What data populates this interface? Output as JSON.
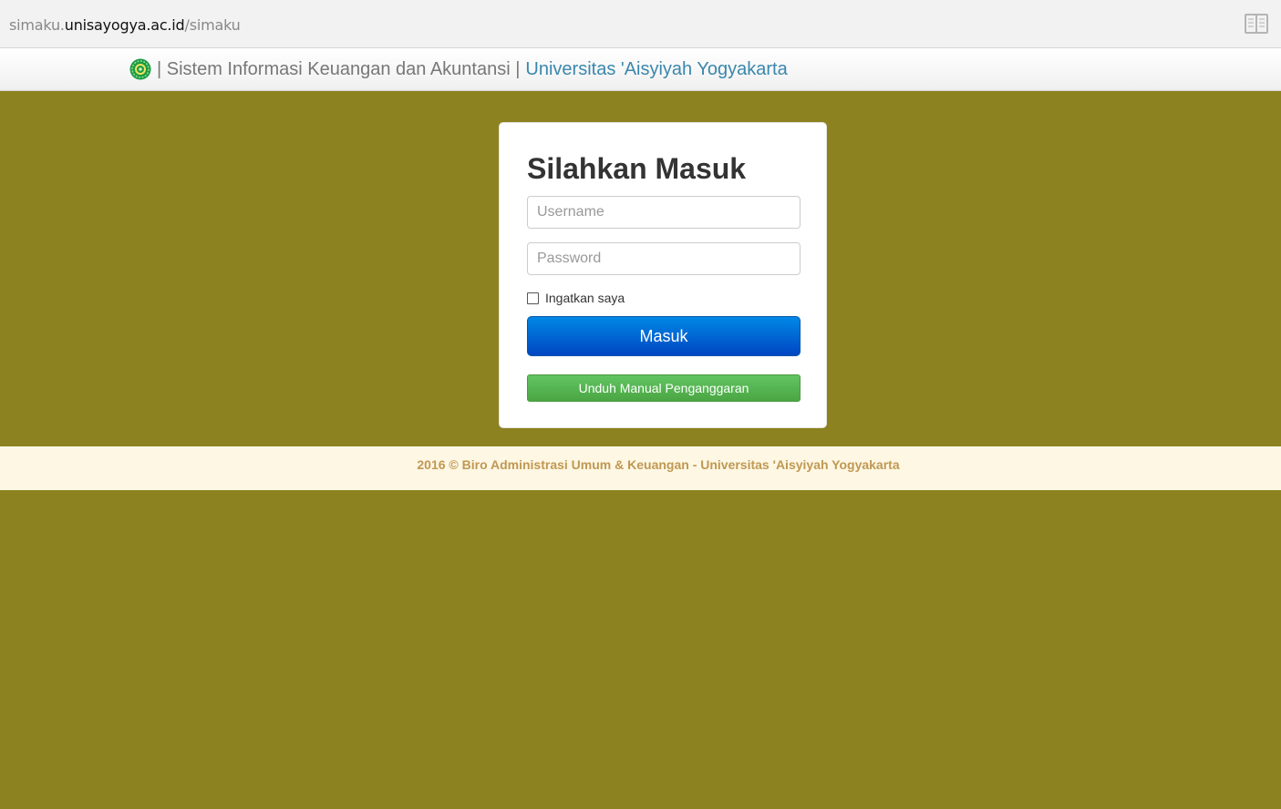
{
  "browser": {
    "url_prefix": "simaku.",
    "url_host": "unisayogya.ac.id",
    "url_path": "/simaku"
  },
  "navbar": {
    "brand_text": "| Sistem Informasi Keuangan dan Akuntansi |",
    "brand_university": "Universitas 'Aisyiyah Yogyakarta"
  },
  "login": {
    "title": "Silahkan Masuk",
    "username_placeholder": "Username",
    "password_placeholder": "Password",
    "remember_label": "Ingatkan saya",
    "remember_checked": false,
    "submit_label": "Masuk",
    "manual_label": "Unduh Manual Penganggaran"
  },
  "footer": {
    "text": "2016 © Biro Administrasi Umum & Keuangan - Universitas 'Aisyiyah Yogyakarta"
  },
  "colors": {
    "background": "#8c821f",
    "brand_link": "#3a87ad",
    "login_button": "#0066d6",
    "manual_button": "#5bb75b",
    "footer_text": "#c09853"
  },
  "icons": [
    "reader-view-icon",
    "university-logo-icon"
  ]
}
